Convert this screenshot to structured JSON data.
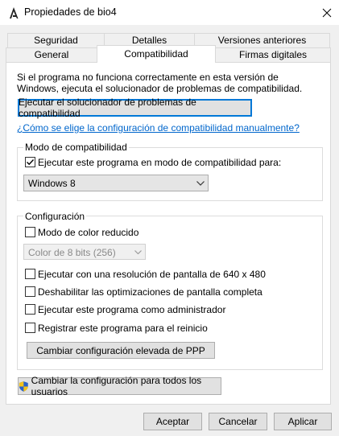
{
  "window": {
    "title": "Propiedades de bio4"
  },
  "tabs_row1": [
    {
      "label": "Seguridad"
    },
    {
      "label": "Detalles"
    },
    {
      "label": "Versiones anteriores"
    }
  ],
  "tabs_row2": [
    {
      "label": "General"
    },
    {
      "label": "Compatibilidad"
    },
    {
      "label": "Firmas digitales"
    }
  ],
  "intro": {
    "line1": "Si el programa no funciona correctamente en esta versión de",
    "line2": "Windows, ejecuta el solucionador de problemas de compatibilidad."
  },
  "troubleshooter_button": "Ejecutar el solucionador de problemas de compatibilidad",
  "manual_link": "¿Cómo se elige la configuración de compatibilidad manualmente?",
  "compat_mode": {
    "legend": "Modo de compatibilidad",
    "checkbox_label": "Ejecutar este programa en modo de compatibilidad para:",
    "checked": true,
    "selected_os": "Windows 8"
  },
  "settings": {
    "legend": "Configuración",
    "reduced_color": "Modo de color reducido",
    "color_select": "Color de 8 bits (256)",
    "resolution": "Ejecutar con una resolución de pantalla de 640 x 480",
    "fullscreen_opt": "Deshabilitar las optimizaciones de pantalla completa",
    "admin": "Ejecutar este programa como administrador",
    "restart": "Registrar este programa para el reinicio",
    "dpi_button": "Cambiar configuración elevada de PPP"
  },
  "all_users_button": "Cambiar la configuración para todos los usuarios",
  "footer": {
    "accept": "Aceptar",
    "cancel": "Cancelar",
    "apply": "Aplicar"
  }
}
